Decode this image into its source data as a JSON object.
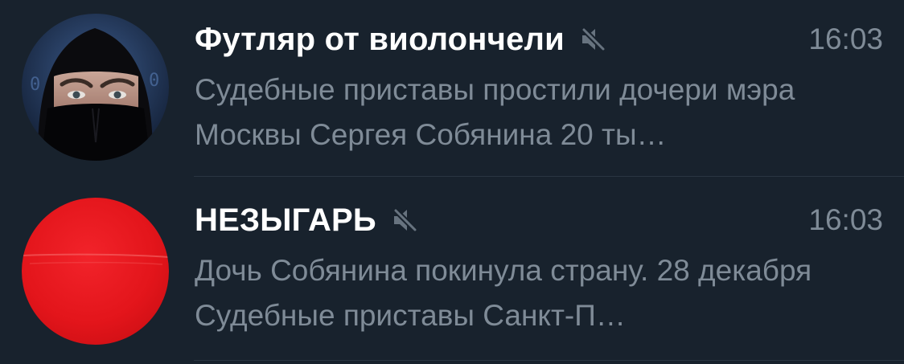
{
  "chats": [
    {
      "title": "Футляр от виолончели",
      "muted": true,
      "time": "16:03",
      "preview": "Судебные приставы простили дочери мэра Москвы Сергея Собянина 20 ты…",
      "avatar": "masked-person-photo"
    },
    {
      "title": "НЕЗЫГАРЬ",
      "muted": true,
      "time": "16:03",
      "preview": "Дочь Собянина покинула страну. 28 декабря Судебные приставы Санкт-П…",
      "avatar": "red-circle-logo"
    }
  ],
  "colors": {
    "background": "#18222d",
    "title": "#ffffff",
    "secondary_text": "#7f8b97",
    "divider": "#2a3542",
    "avatar_red": "#e3151b"
  }
}
